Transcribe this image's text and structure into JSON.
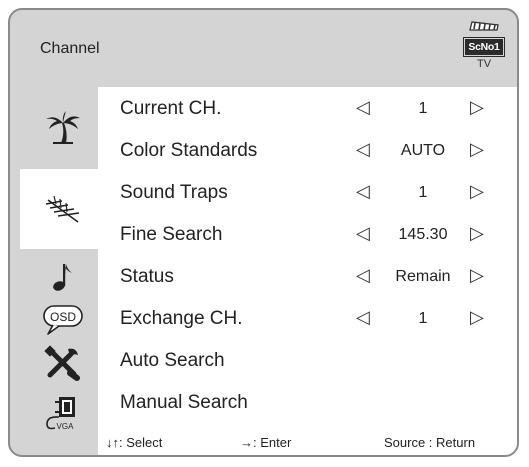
{
  "header": {
    "title": "Channel",
    "logo_brand": "ScNo1",
    "logo_subtitle": "TV"
  },
  "sidebar": {
    "items": [
      {
        "name": "palm-tree-icon",
        "active": false
      },
      {
        "name": "antenna-icon",
        "active": true
      },
      {
        "name": "music-note-icon",
        "active": false
      },
      {
        "name": "osd-icon",
        "label": "OSD",
        "active": false
      },
      {
        "name": "tools-icon",
        "active": false
      },
      {
        "name": "vga-icon",
        "label": "VGA",
        "active": false
      }
    ]
  },
  "menu": {
    "rows": [
      {
        "label": "Current CH.",
        "value": "1"
      },
      {
        "label": "Color Standards",
        "value": "AUTO"
      },
      {
        "label": "Sound Traps",
        "value": "1"
      },
      {
        "label": "Fine Search",
        "value": "145.30"
      },
      {
        "label": "Status",
        "value": "Remain"
      },
      {
        "label": "Exchange CH.",
        "value": "1"
      },
      {
        "label": "Auto Search",
        "value": null
      },
      {
        "label": "Manual Search",
        "value": null
      }
    ],
    "left_arrow": "◁",
    "right_arrow": "▷"
  },
  "footer": {
    "select_hint": "↓↑: Select",
    "enter_hint": "→: Enter",
    "return_hint": "Source : Return"
  },
  "colors": {
    "frame_background": "#d4d4d4",
    "panel_background": "#ffffff",
    "text": "#222222"
  }
}
